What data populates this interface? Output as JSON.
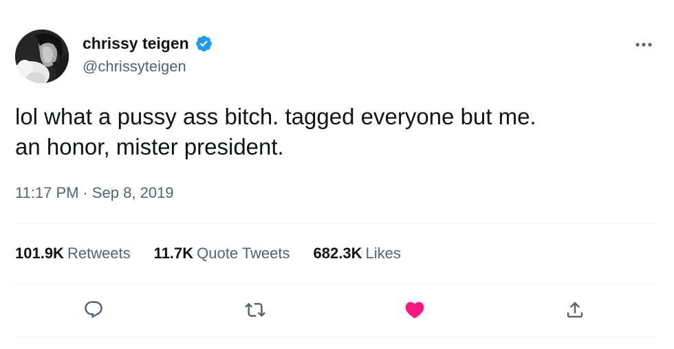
{
  "author": {
    "display_name": "chrissy teigen",
    "handle": "@chrissyteigen",
    "verified": true
  },
  "tweet": {
    "text_lines": [
      "lol what a pussy ass bitch. tagged everyone but me.",
      "an honor, mister president."
    ],
    "time": "11:17 PM",
    "separator": "·",
    "date": "Sep 8, 2019"
  },
  "stats": {
    "retweets_count": "101.9K",
    "retweets_label": "Retweets",
    "quotes_count": "11.7K",
    "quotes_label": "Quote Tweets",
    "likes_count": "682.3K",
    "likes_label": "Likes"
  },
  "icons": {
    "more": "more-horizontal-icon",
    "verified": "verified-badge-icon",
    "reply": "reply-icon",
    "retweet": "retweet-icon",
    "like": "heart-icon",
    "share": "share-icon"
  },
  "colors": {
    "text_primary": "#0f1419",
    "text_secondary": "#536471",
    "verified_blue": "#1d9bf0",
    "like_pink": "#f91880",
    "divider": "#eff3f4"
  }
}
